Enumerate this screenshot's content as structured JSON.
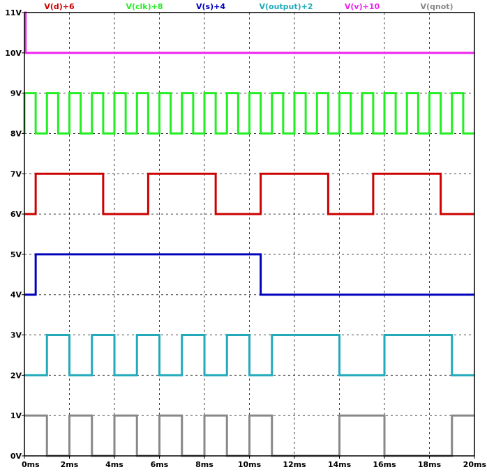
{
  "chart_data": {
    "type": "line",
    "title": "",
    "xlabel": "",
    "ylabel": "",
    "xlim": [
      0,
      20
    ],
    "ylim": [
      0,
      11
    ],
    "x_unit": "ms",
    "y_unit": "V",
    "grid": true,
    "legend_position": "top",
    "xticks": [
      "0ms",
      "2ms",
      "4ms",
      "6ms",
      "8ms",
      "10ms",
      "12ms",
      "14ms",
      "16ms",
      "18ms",
      "20ms"
    ],
    "yticks": [
      "0V",
      "1V",
      "2V",
      "3V",
      "4V",
      "5V",
      "6V",
      "7V",
      "8V",
      "9V",
      "10V",
      "11V"
    ],
    "series": [
      {
        "name": "V(d)+6",
        "color": "#cc0000",
        "x": [
          0,
          0.5,
          0.5,
          3.5,
          3.5,
          5.5,
          5.5,
          8.5,
          8.5,
          10.5,
          10.5,
          13.5,
          13.5,
          15.5,
          15.5,
          18.5,
          18.5,
          20
        ],
        "y": [
          6,
          6,
          7,
          7,
          6,
          6,
          7,
          7,
          6,
          6,
          7,
          7,
          6,
          6,
          7,
          7,
          6,
          6
        ]
      },
      {
        "name": "V(clk)+8",
        "color": "#22ee22",
        "period": 1,
        "duty": 0.5,
        "low": 8,
        "high": 9,
        "start": 0,
        "end": 20
      },
      {
        "name": "V(s)+4",
        "color": "#0000bb",
        "x": [
          0,
          0.5,
          0.5,
          10.5,
          10.5,
          20
        ],
        "y": [
          4,
          4,
          5,
          5,
          4,
          4
        ]
      },
      {
        "name": "V(output)+2",
        "color": "#22aabb",
        "x": [
          0,
          1,
          1,
          2,
          2,
          3,
          3,
          4,
          4,
          5,
          5,
          6,
          6,
          7,
          7,
          8,
          8,
          9,
          9,
          10,
          10,
          11,
          11,
          14,
          14,
          16,
          16,
          19,
          19,
          20
        ],
        "y": [
          2,
          2,
          3,
          3,
          2,
          2,
          3,
          3,
          2,
          2,
          3,
          3,
          2,
          2,
          3,
          3,
          2,
          2,
          3,
          3,
          2,
          2,
          3,
          3,
          2,
          2,
          3,
          3,
          2,
          2
        ]
      },
      {
        "name": "V(v)+10",
        "color": "#ee22ee",
        "x": [
          0,
          0.05,
          0.05,
          20
        ],
        "y": [
          11,
          11,
          10,
          10
        ]
      },
      {
        "name": "V(qnot)",
        "color": "#888888",
        "x": [
          0,
          1,
          1,
          2,
          2,
          3,
          3,
          4,
          4,
          5,
          5,
          6,
          6,
          7,
          7,
          8,
          8,
          9,
          9,
          10,
          10,
          11,
          11,
          14,
          14,
          16,
          16,
          19,
          19,
          20
        ],
        "y": [
          1,
          1,
          0,
          0,
          1,
          1,
          0,
          0,
          1,
          1,
          0,
          0,
          1,
          1,
          0,
          0,
          1,
          1,
          0,
          0,
          1,
          1,
          0,
          0,
          1,
          1,
          0,
          0,
          1,
          1
        ]
      }
    ]
  }
}
